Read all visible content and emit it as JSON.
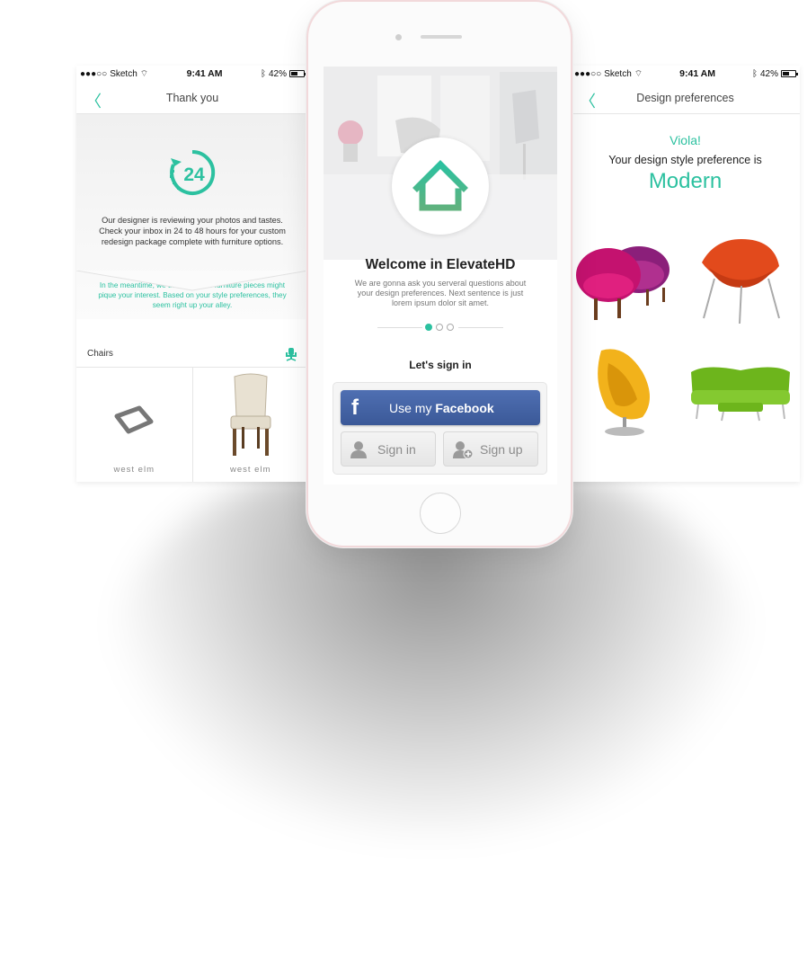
{
  "colors": {
    "accent": "#2cc1a0",
    "facebook": "#3b5998"
  },
  "status_bar": {
    "signal": "●●●○○",
    "carrier": "Sketch",
    "time": "9:41 AM",
    "battery": "42%"
  },
  "left_screen": {
    "title": "Thank you",
    "back_icon": "chevron-left-icon",
    "badge_number": "24",
    "message": "Our designer is reviewing your photos and tastes. Check your inbox in 24 to 48 hours for your custom redesign package complete with furniture options.",
    "note": "In the meantime, we thought these furniture pieces might pique your interest. Based on your style preferences, they seem right up your alley.",
    "section_label": "Chairs",
    "products": [
      {
        "brand": "west elm"
      },
      {
        "brand": "west elm"
      }
    ]
  },
  "center_screen": {
    "welcome_title": "Welcome in ElevateHD",
    "welcome_subtitle": "We are gonna ask you serveral questions about your design preferences. Next sentence is just lorem ipsum dolor sit amet.",
    "page_count": 3,
    "active_page": 0,
    "signin_heading": "Let's sign in",
    "facebook_button": {
      "prefix": "Use my ",
      "brand": "Facebook",
      "icon": "f"
    },
    "signin_button": "Sign in",
    "signup_button": "Sign up"
  },
  "right_screen": {
    "title": "Design preferences",
    "exclaim": "Viola!",
    "line": "Your design style preference is",
    "style": "Modern"
  }
}
